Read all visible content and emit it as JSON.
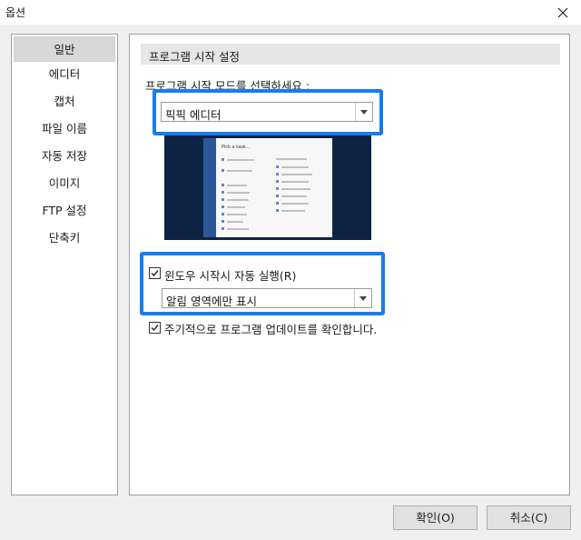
{
  "window": {
    "title": "옵션"
  },
  "sidebar": {
    "items": [
      {
        "label": "일반",
        "selected": true
      },
      {
        "label": "에디터"
      },
      {
        "label": "캡처"
      },
      {
        "label": "파일 이름"
      },
      {
        "label": "자동 저장"
      },
      {
        "label": "이미지"
      },
      {
        "label": "FTP 설정"
      },
      {
        "label": "단축키"
      }
    ]
  },
  "content": {
    "section_title": "프로그램 시작 설정",
    "mode_label": "프로그램 시작 모드를 선택하세요 :",
    "mode_combo_value": "픽픽 에디터",
    "preview_title": "Pick a task...",
    "autostart": {
      "checked": true,
      "label": "윈도우 시작시 자동 실행(R)"
    },
    "autostart_combo_value": "알림 영역에만 표시",
    "update_check": {
      "checked": true,
      "label": "주기적으로 프로그램 업데이트를 확인합니다."
    }
  },
  "buttons": {
    "ok": "확인(O)",
    "cancel": "취소(C)"
  },
  "colors": {
    "highlight": "#1a7bf0",
    "preview_bg": "#0e2344"
  }
}
